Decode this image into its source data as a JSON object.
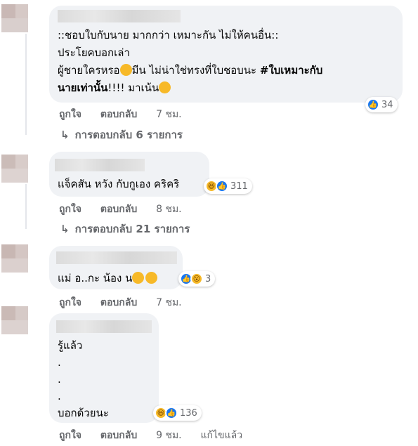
{
  "comments": [
    {
      "lines": [
        "::ชอบใบกับนาย มากกว่า เหมาะกัน ไม่ให้คนอื่น::",
        "ประโยคบอกเล่า",
        "ผู้ชายใครหรอ",
        "มีน ไม่น่าใช่ทรงที่ใบชอบนะ ",
        "#ใบเหมาะกับ",
        "นายเท่านั้น",
        "!!!! มาเน้น"
      ],
      "reaction_count": "34",
      "like": "ถูกใจ",
      "reply": "ตอบกลับ",
      "time": "7 ชม.",
      "replies_label": "การตอบกลับ 6 รายการ"
    },
    {
      "lines": [
        "แจ็คสัน หวัง กับกูเอง คริคริ"
      ],
      "reaction_count": "311",
      "like": "ถูกใจ",
      "reply": "ตอบกลับ",
      "time": "8 ชม.",
      "replies_label": "การตอบกลับ 21 รายการ"
    },
    {
      "lines": [
        "แม่ อ..กะ น้อง น"
      ],
      "reaction_count": "3",
      "like": "ถูกใจ",
      "reply": "ตอบกลับ",
      "time": "7 ชม."
    },
    {
      "lines": [
        "รู้แล้ว",
        ".",
        ".",
        ".",
        "บอกด้วยนะ"
      ],
      "reaction_count": "136",
      "like": "ถูกใจ",
      "reply": "ตอบกลับ",
      "time": "9 ชม.",
      "edited": "แก้ไขแล้ว"
    }
  ],
  "icons": {
    "reply_arrow": "reply-arrow-icon",
    "like": "like-icon",
    "haha": "haha-icon",
    "wow": "wow-icon"
  },
  "colors": {
    "bubble": "#f0f2f5",
    "meta": "#65676b",
    "like_blue": "#1877f2"
  }
}
